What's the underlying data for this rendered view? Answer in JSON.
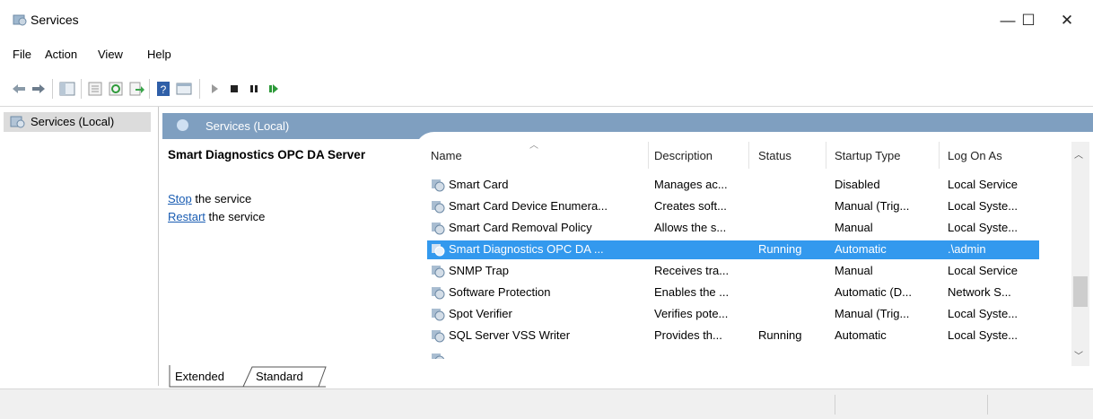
{
  "window": {
    "title": "Services",
    "minimize": "—",
    "maximize": "☐",
    "close": "✕"
  },
  "menu": {
    "items": [
      "File",
      "Action",
      "View",
      "Help"
    ]
  },
  "toolbar": {
    "icons": [
      "back-icon",
      "forward-icon",
      "show-hide-tree-icon",
      "properties-icon",
      "refresh-icon",
      "export-icon",
      "help-icon",
      "mmc-view-icon",
      "start-service-icon",
      "stop-service-icon",
      "pause-service-icon",
      "resume-service-icon"
    ]
  },
  "tree": {
    "selected_label": "Services (Local)"
  },
  "panel": {
    "header_label": "Services (Local)"
  },
  "description": {
    "service_name": "Smart Diagnostics OPC DA Server",
    "stop_link": "Stop",
    "stop_rest": " the service",
    "restart_link": "Restart",
    "restart_rest": " the service"
  },
  "table": {
    "columns": [
      "Name",
      "Description",
      "Status",
      "Startup Type",
      "Log On As"
    ],
    "rows": [
      {
        "name": "Smart Card",
        "description": "Manages ac...",
        "status": "",
        "startup": "Disabled",
        "logon": "Local Service",
        "selected": false
      },
      {
        "name": "Smart Card Device Enumera...",
        "description": "Creates soft...",
        "status": "",
        "startup": "Manual (Trig...",
        "logon": "Local Syste...",
        "selected": false
      },
      {
        "name": "Smart Card Removal Policy",
        "description": "Allows the s...",
        "status": "",
        "startup": "Manual",
        "logon": "Local Syste...",
        "selected": false
      },
      {
        "name": "Smart Diagnostics OPC DA ...",
        "description": "",
        "status": "Running",
        "startup": "Automatic",
        "logon": ".\\admin",
        "selected": true
      },
      {
        "name": "SNMP Trap",
        "description": "Receives tra...",
        "status": "",
        "startup": "Manual",
        "logon": "Local Service",
        "selected": false
      },
      {
        "name": "Software Protection",
        "description": "Enables the ...",
        "status": "",
        "startup": "Automatic (D...",
        "logon": "Network S...",
        "selected": false
      },
      {
        "name": "Spot Verifier",
        "description": "Verifies pote...",
        "status": "",
        "startup": "Manual (Trig...",
        "logon": "Local Syste...",
        "selected": false
      },
      {
        "name": "SQL Server VSS Writer",
        "description": "Provides th...",
        "status": "Running",
        "startup": "Automatic",
        "logon": "Local Syste...",
        "selected": false
      }
    ]
  },
  "tabs": {
    "extended": "Extended",
    "standard": "Standard",
    "active": "Extended"
  },
  "colors": {
    "selection": "#3399ee",
    "header_band": "#7f9fc0",
    "link": "#1a5db3"
  }
}
